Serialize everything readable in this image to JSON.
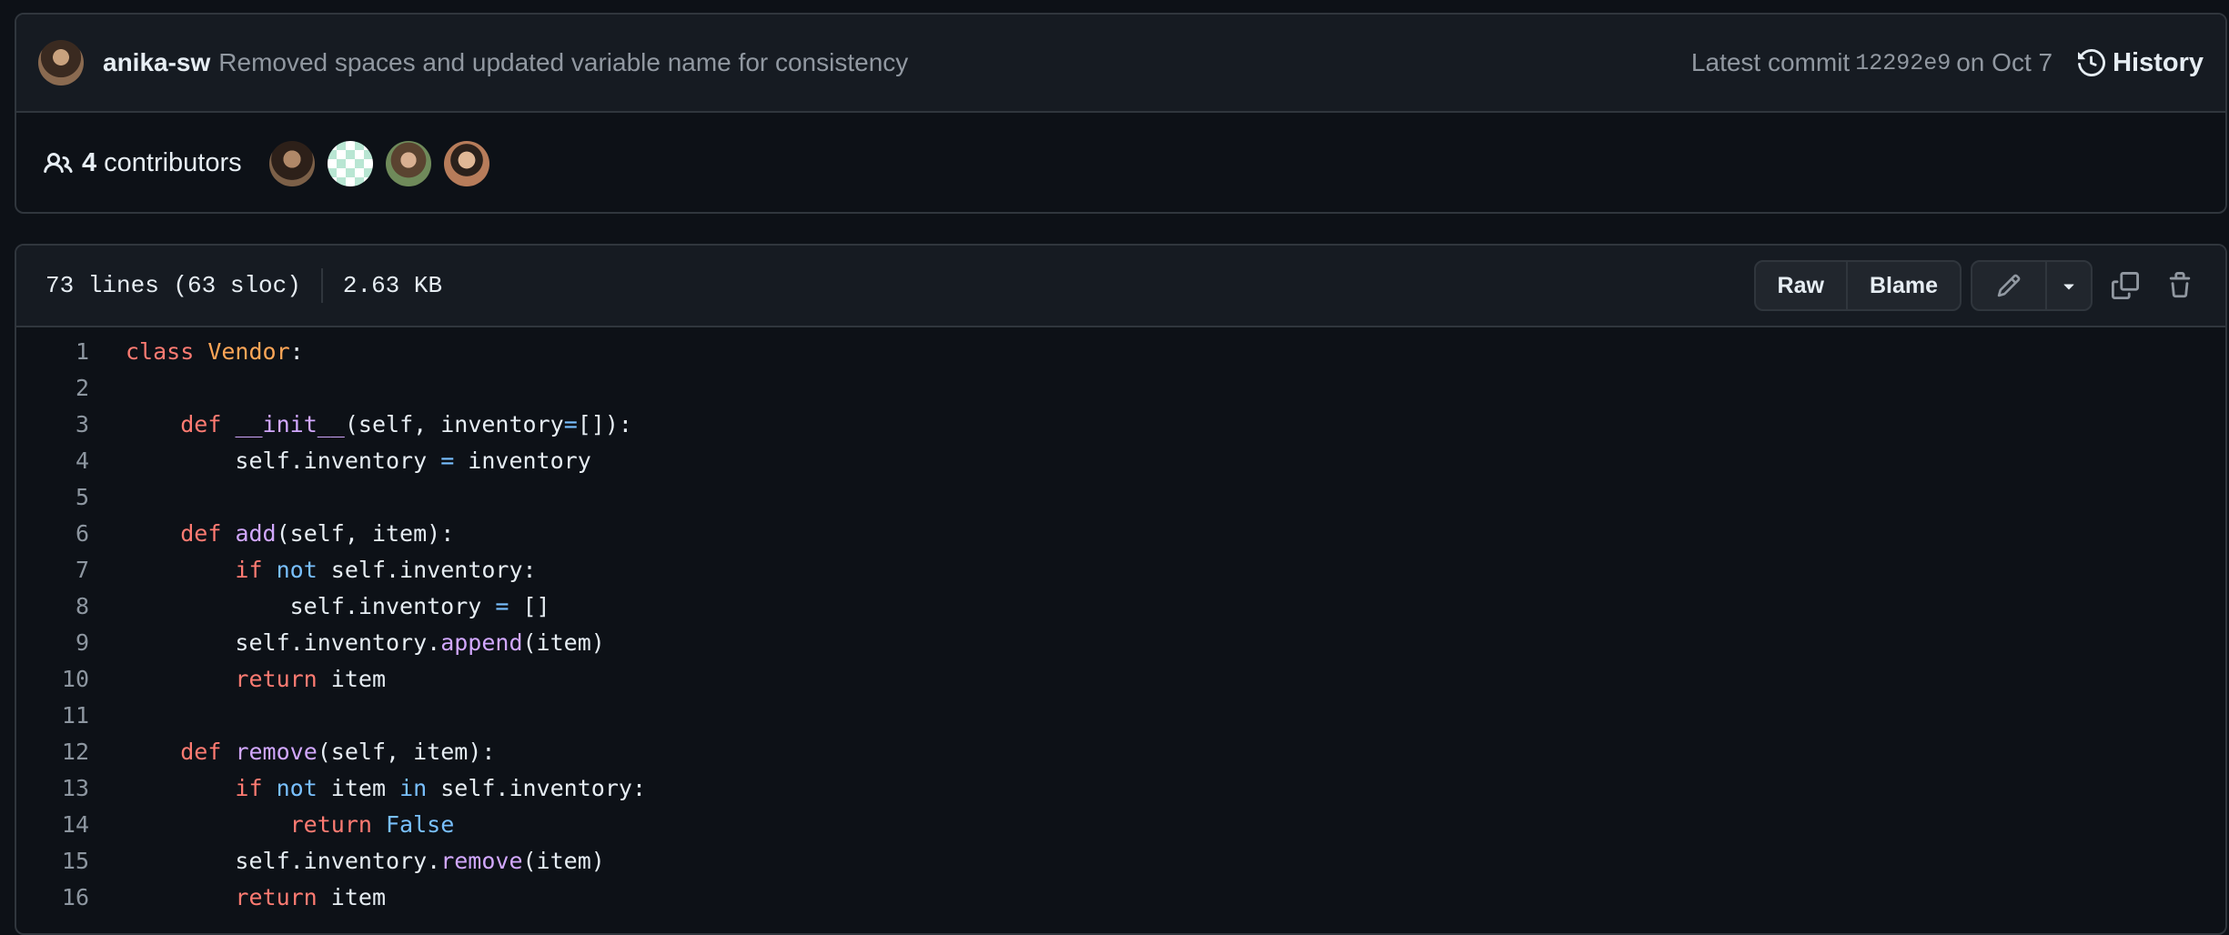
{
  "commit": {
    "author": "anika-sw",
    "message": "Removed spaces and updated variable name for consistency",
    "latest_label": "Latest commit",
    "sha": "12292e9",
    "date_text": "on Oct 7",
    "history_label": "History"
  },
  "contributors": {
    "count": "4",
    "label": "contributors"
  },
  "file": {
    "lines_info": "73 lines (63 sloc)",
    "size": "2.63 KB",
    "raw_label": "Raw",
    "blame_label": "Blame"
  },
  "code": {
    "line_numbers": [
      "1",
      "2",
      "3",
      "4",
      "5",
      "6",
      "7",
      "8",
      "9",
      "10",
      "11",
      "12",
      "13",
      "14",
      "15",
      "16"
    ],
    "lines": [
      [
        {
          "t": "class",
          "c": "k"
        },
        {
          "t": " "
        },
        {
          "t": "Vendor",
          "c": "c"
        },
        {
          "t": ":"
        }
      ],
      [],
      [
        {
          "t": "    "
        },
        {
          "t": "def",
          "c": "k"
        },
        {
          "t": " "
        },
        {
          "t": "__init__",
          "c": "f"
        },
        {
          "t": "(self, inventory"
        },
        {
          "t": "=",
          "c": "o"
        },
        {
          "t": "[]):"
        }
      ],
      [
        {
          "t": "        self.inventory "
        },
        {
          "t": "=",
          "c": "o"
        },
        {
          "t": " inventory"
        }
      ],
      [],
      [
        {
          "t": "    "
        },
        {
          "t": "def",
          "c": "k"
        },
        {
          "t": " "
        },
        {
          "t": "add",
          "c": "f"
        },
        {
          "t": "(self, item):"
        }
      ],
      [
        {
          "t": "        "
        },
        {
          "t": "if",
          "c": "k"
        },
        {
          "t": " "
        },
        {
          "t": "not",
          "c": "o"
        },
        {
          "t": " self.inventory:"
        }
      ],
      [
        {
          "t": "            self.inventory "
        },
        {
          "t": "=",
          "c": "o"
        },
        {
          "t": " []"
        }
      ],
      [
        {
          "t": "        self.inventory."
        },
        {
          "t": "append",
          "c": "f"
        },
        {
          "t": "(item)"
        }
      ],
      [
        {
          "t": "        "
        },
        {
          "t": "return",
          "c": "k"
        },
        {
          "t": " item"
        }
      ],
      [],
      [
        {
          "t": "    "
        },
        {
          "t": "def",
          "c": "k"
        },
        {
          "t": " "
        },
        {
          "t": "remove",
          "c": "f"
        },
        {
          "t": "(self, item):"
        }
      ],
      [
        {
          "t": "        "
        },
        {
          "t": "if",
          "c": "k"
        },
        {
          "t": " "
        },
        {
          "t": "not",
          "c": "o"
        },
        {
          "t": " item "
        },
        {
          "t": "in",
          "c": "o"
        },
        {
          "t": " self.inventory:"
        }
      ],
      [
        {
          "t": "            "
        },
        {
          "t": "return",
          "c": "k"
        },
        {
          "t": " "
        },
        {
          "t": "False",
          "c": "o"
        }
      ],
      [
        {
          "t": "        self.inventory."
        },
        {
          "t": "remove",
          "c": "f"
        },
        {
          "t": "(item)"
        }
      ],
      [
        {
          "t": "        "
        },
        {
          "t": "return",
          "c": "k"
        },
        {
          "t": " item"
        }
      ]
    ]
  },
  "colors": {
    "keyword": "#ff7b72",
    "class_name": "#ffa657",
    "function": "#d2a8ff",
    "operator": "#79c0ff",
    "background": "#0d1117",
    "header_bg": "#161b22"
  },
  "icons": [
    "people-icon",
    "history-icon",
    "pencil-icon",
    "triangle-down-icon",
    "copy-icon",
    "trash-icon"
  ]
}
